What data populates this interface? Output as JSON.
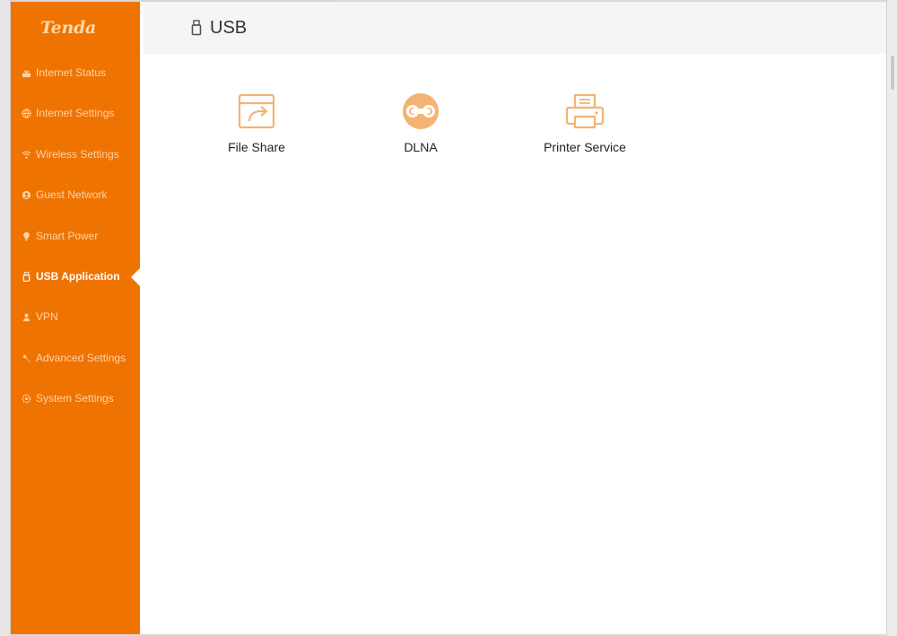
{
  "brand": {
    "logo_text": "Tenda",
    "accent_color": "#ef7300"
  },
  "sidebar": {
    "items": [
      {
        "label": "Internet Status",
        "icon": "router-icon",
        "active": false
      },
      {
        "label": "Internet Settings",
        "icon": "globe-icon",
        "active": false
      },
      {
        "label": "Wireless Settings",
        "icon": "wifi-icon",
        "active": false
      },
      {
        "label": "Guest Network",
        "icon": "guest-icon",
        "active": false
      },
      {
        "label": "Smart Power",
        "icon": "bulb-icon",
        "active": false
      },
      {
        "label": "USB Application",
        "icon": "usb-icon",
        "active": true
      },
      {
        "label": "VPN",
        "icon": "vpn-icon",
        "active": false
      },
      {
        "label": "Advanced Settings",
        "icon": "wrench-icon",
        "active": false
      },
      {
        "label": "System Settings",
        "icon": "gear-icon",
        "active": false
      }
    ]
  },
  "header": {
    "title": "USB",
    "icon": "usb-icon"
  },
  "apps": [
    {
      "label": "File Share",
      "icon": "file-share-icon"
    },
    {
      "label": "DLNA",
      "icon": "dlna-icon"
    },
    {
      "label": "Printer Service",
      "icon": "printer-icon"
    }
  ]
}
